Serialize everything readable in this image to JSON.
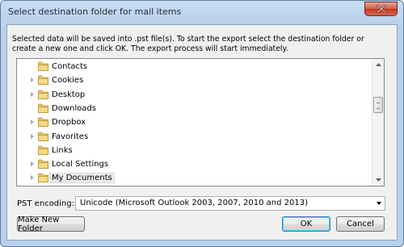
{
  "window": {
    "title": "Select destination folder for mail items"
  },
  "description": "Selected data will be saved into .pst file(s). To start the export select the destination folder or create a new one and click OK. The export process will start immediately.",
  "tree": {
    "items": [
      {
        "label": "Contacts",
        "expandable": false,
        "selected": false
      },
      {
        "label": "Cookies",
        "expandable": true,
        "selected": false
      },
      {
        "label": "Desktop",
        "expandable": true,
        "selected": false
      },
      {
        "label": "Downloads",
        "expandable": false,
        "selected": false
      },
      {
        "label": "Dropbox",
        "expandable": true,
        "selected": false
      },
      {
        "label": "Favorites",
        "expandable": true,
        "selected": false
      },
      {
        "label": "Links",
        "expandable": false,
        "selected": false
      },
      {
        "label": "Local Settings",
        "expandable": true,
        "selected": false
      },
      {
        "label": "My Documents",
        "expandable": true,
        "selected": true
      }
    ]
  },
  "encoding": {
    "label": "PST encoding:",
    "selected": "Unicode (Microsoft Outlook 2003, 2007, 2010 and 2013)"
  },
  "buttons": {
    "make_new_folder": "Make New Folder",
    "ok": "OK",
    "cancel": "Cancel"
  },
  "icons": {
    "close": "close-icon",
    "folder": "folder-icon",
    "expand": "expand-arrow-icon"
  }
}
